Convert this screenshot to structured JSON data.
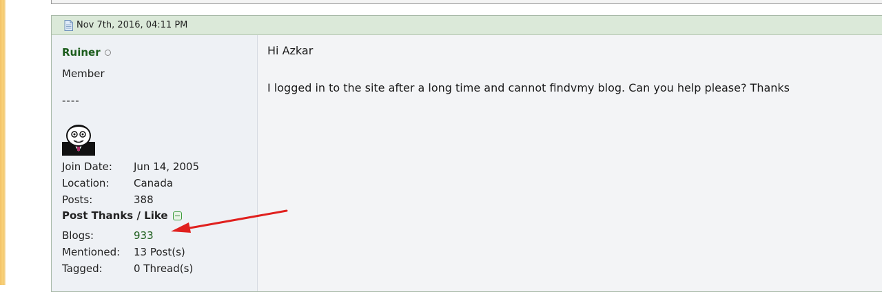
{
  "post": {
    "date": "Nov 7th, 2016, 04:11 PM",
    "user": {
      "name": "Ruiner",
      "title": "Member",
      "separator": "----",
      "stats": [
        {
          "label": "Join Date:",
          "value": "Jun 14, 2005"
        },
        {
          "label": "Location:",
          "value": "Canada"
        },
        {
          "label": "Posts:",
          "value": "388"
        }
      ],
      "thanks_header": "Post Thanks / Like",
      "extra_stats": [
        {
          "label": "Blogs:",
          "value": "933"
        },
        {
          "label": "Mentioned:",
          "value": "13 Post(s)"
        },
        {
          "label": "Tagged:",
          "value": "0 Thread(s)"
        }
      ]
    },
    "message": {
      "greeting": "Hi Azkar",
      "text": "I logged in to the site after a long time and cannot findvmy blog. Can you help please? Thanks"
    }
  },
  "colors": {
    "username": "#1b5c1b",
    "header_bg": "#dbe9d9",
    "annotation_arrow": "#e0201e"
  },
  "icons": {
    "post_icon": "document-icon",
    "online_status": "status-dot-icon",
    "collapse": "minus-toggle-icon"
  }
}
